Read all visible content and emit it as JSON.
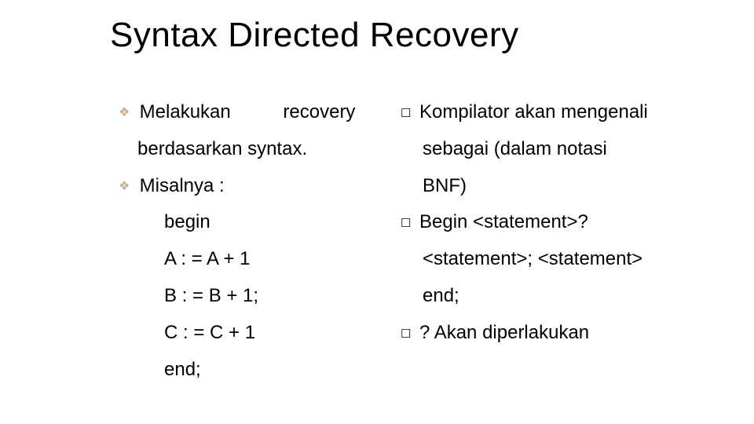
{
  "title": "Syntax Directed Recovery",
  "left": {
    "l1a": "Melakukan",
    "l1b": "recovery",
    "l2": "berdasarkan syntax.",
    "l3": "Misalnya :",
    "code1": "begin",
    "code2": "A : = A + 1",
    "code3": "B : = B + 1;",
    "code4": "C : = C + 1",
    "code5": "end;"
  },
  "right": {
    "r1": "Kompilator akan mengenali",
    "r2": "sebagai (dalam notasi",
    "r3": "BNF)",
    "r4": "Begin <statement>?",
    "r5": "<statement>; <statement>",
    "r6": "end;",
    "r7": "? Akan diperlakukan"
  }
}
